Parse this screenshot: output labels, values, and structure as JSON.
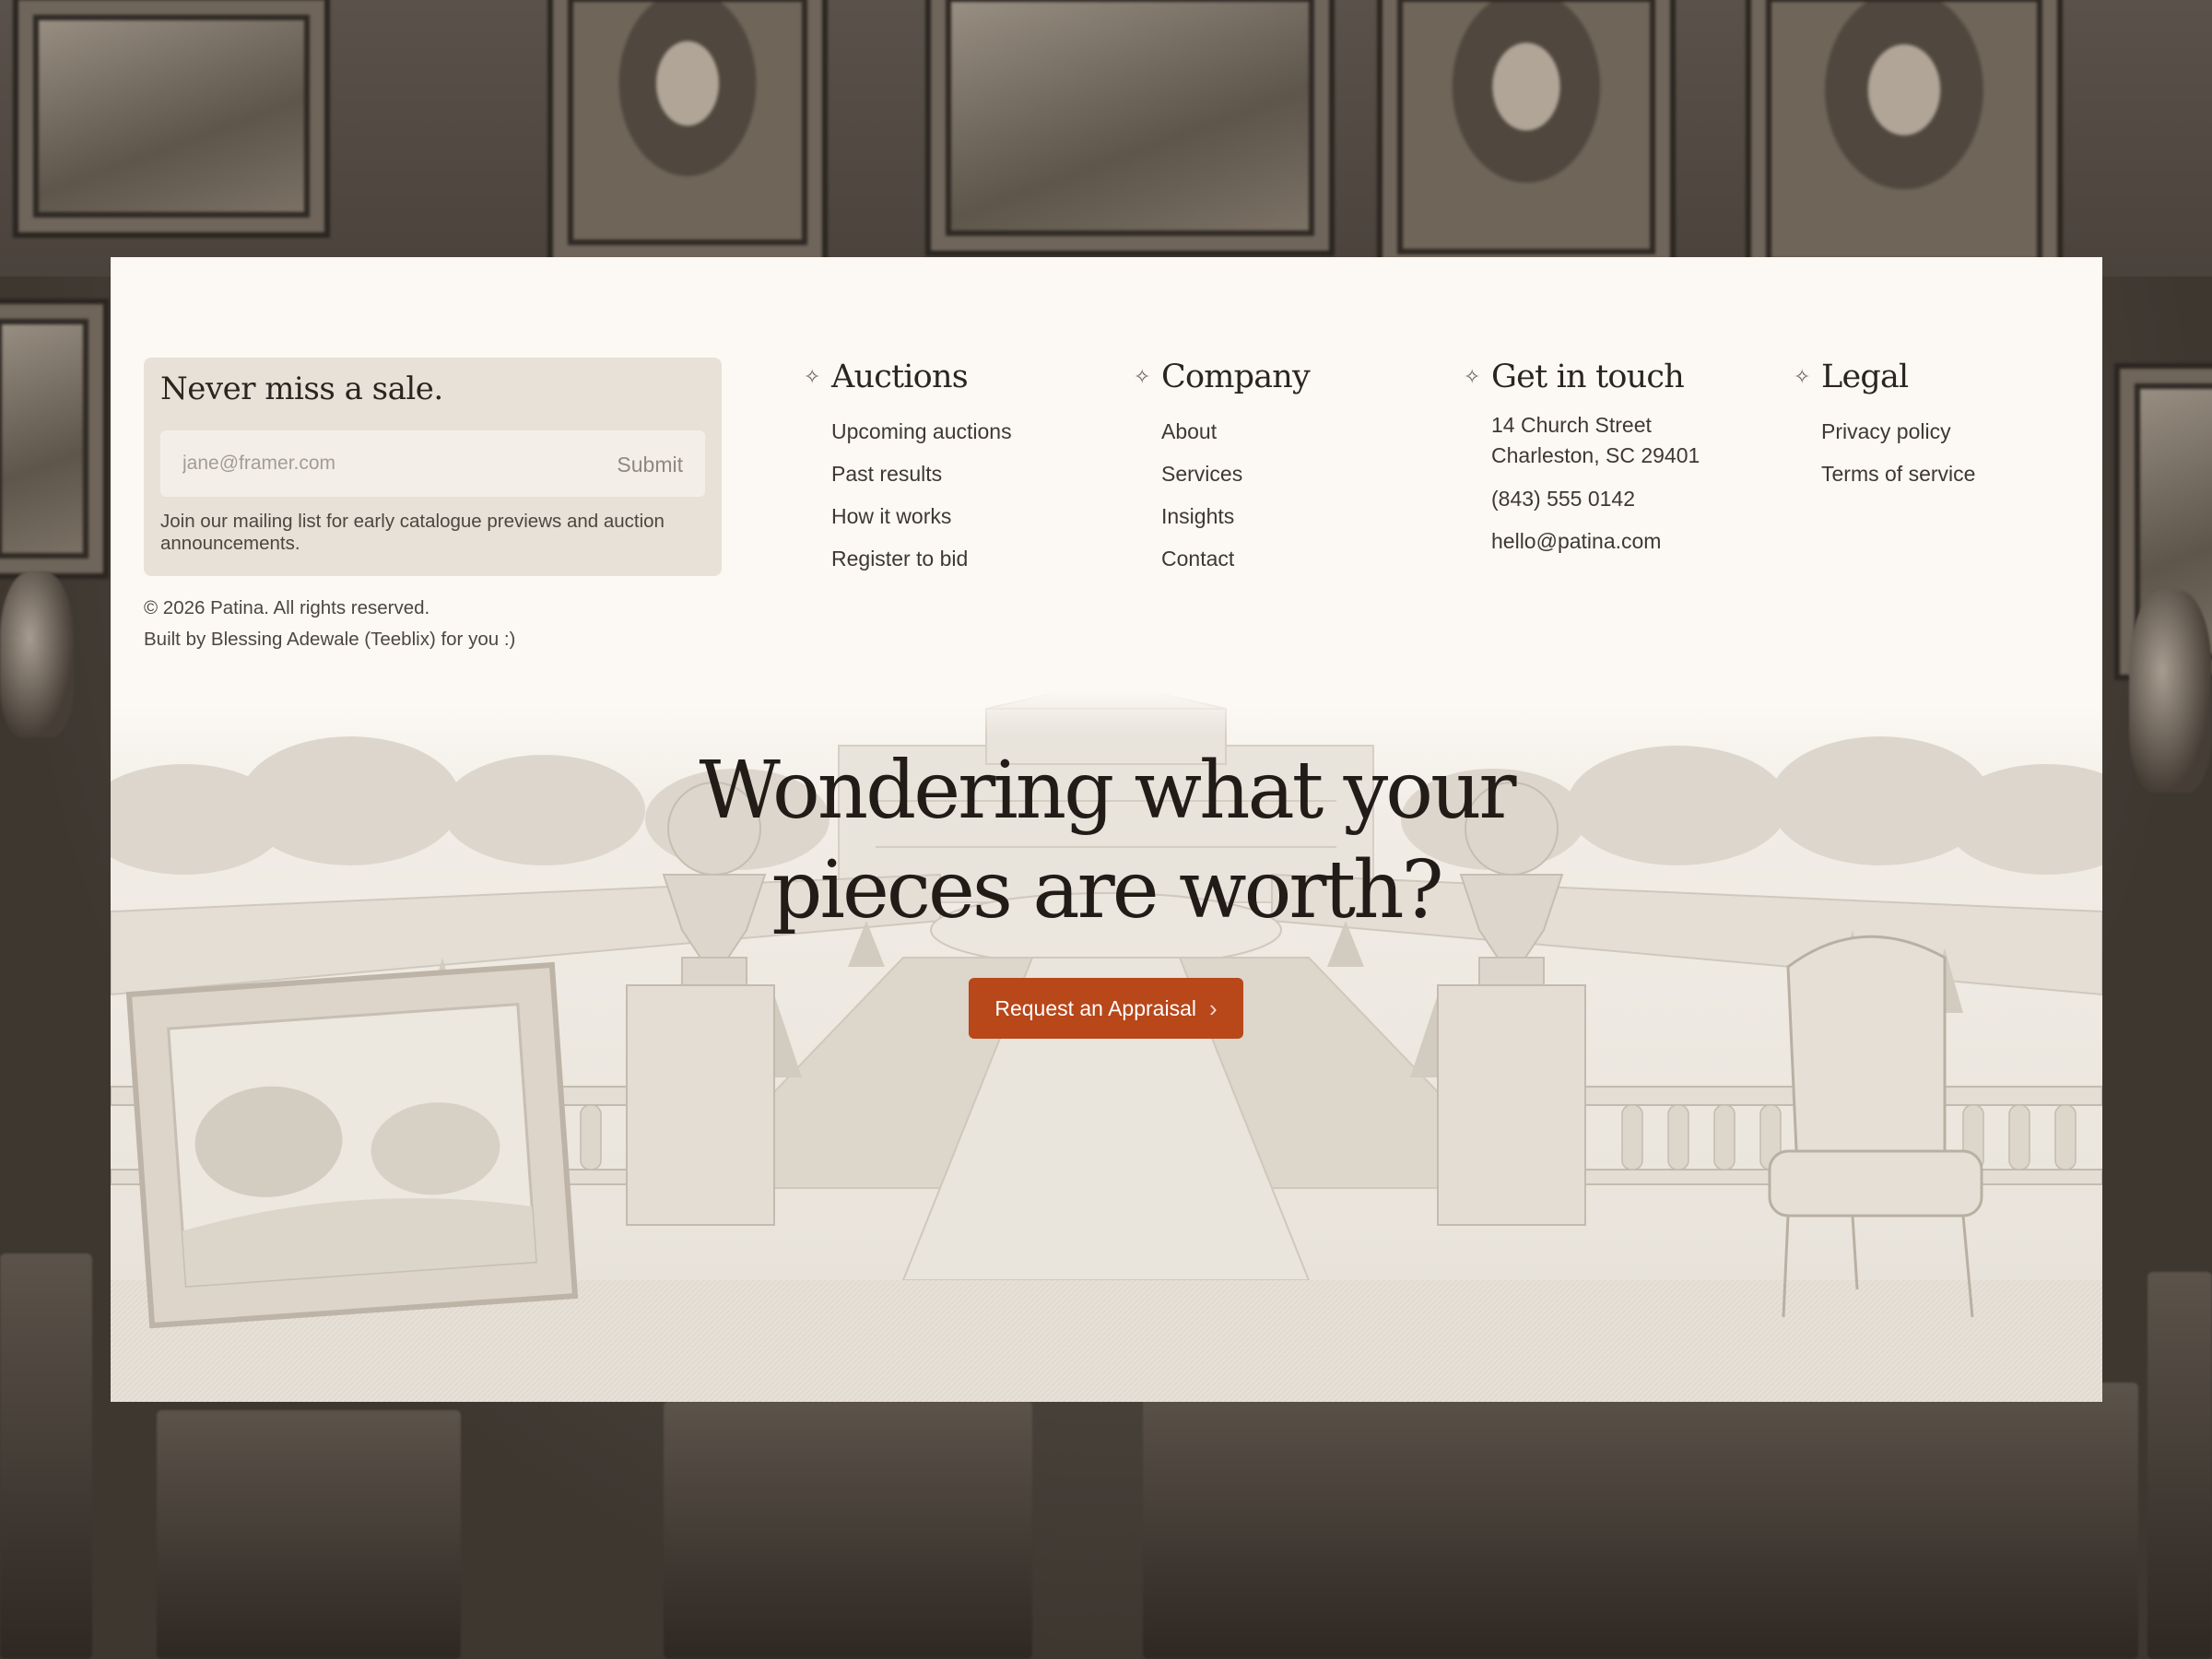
{
  "newsletter": {
    "title": "Never miss a sale.",
    "placeholder": "jane@framer.com",
    "submit_label": "Submit",
    "note": "Join our mailing list for early catalogue previews and auction announcements."
  },
  "footer_meta": {
    "copyright": "© 2026 Patina. All rights reserved.",
    "credit": "Built by Blessing Adewale (Teeblix) for you :)"
  },
  "columns": {
    "auctions": {
      "icon": "sparkle-icon",
      "title": "Auctions",
      "links": [
        "Upcoming auctions",
        "Past results",
        "How it works",
        "Register to bid"
      ]
    },
    "company": {
      "icon": "sparkle-icon",
      "title": "Company",
      "links": [
        "About",
        "Services",
        "Insights",
        "Contact"
      ]
    },
    "contact": {
      "icon": "sparkle-icon",
      "title": "Get in touch",
      "address_line1": "14 Church Street",
      "address_line2": "Charleston, SC 29401",
      "phone": "(843) 555 0142",
      "email": "hello@patina.com"
    },
    "legal": {
      "icon": "sparkle-icon",
      "title": "Legal",
      "links": [
        "Privacy policy",
        "Terms of service"
      ]
    }
  },
  "hero": {
    "headline_line1": "Wondering what your",
    "headline_line2": "pieces are worth?",
    "cta_label": "Request an Appraisal",
    "cta_icon": "chevron-right-icon"
  },
  "colors": {
    "card_bg": "#fcf9f4",
    "panel_bg": "#e7e1d7",
    "accent": "#b8471a",
    "text": "#2b2520"
  }
}
